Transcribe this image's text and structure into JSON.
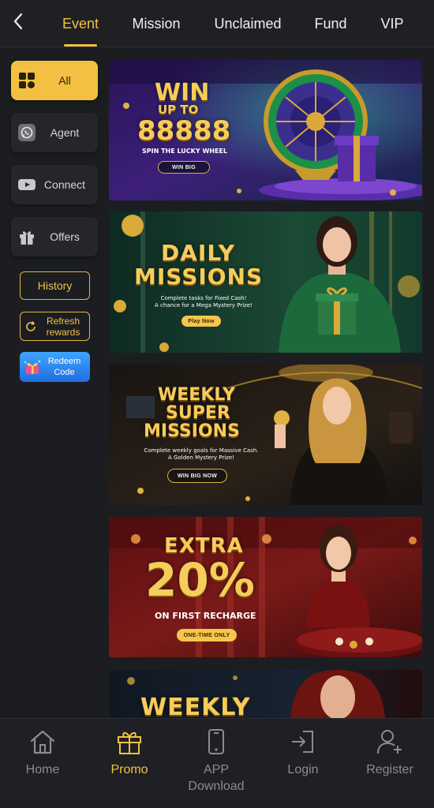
{
  "header": {
    "tabs": [
      {
        "label": "Event",
        "active": true
      },
      {
        "label": "Mission"
      },
      {
        "label": "Unclaimed"
      },
      {
        "label": "Fund"
      },
      {
        "label": "VIP"
      }
    ]
  },
  "sidebar": {
    "categories": [
      {
        "label": "All",
        "icon": "grid-icon",
        "active": true
      },
      {
        "label": "Agent",
        "icon": "whatsapp-icon"
      },
      {
        "label": "Connect",
        "icon": "youtube-icon"
      },
      {
        "label": "Offers",
        "icon": "gift-icon"
      }
    ],
    "history_label": "History",
    "refresh_label_1": "Refresh",
    "refresh_label_2": "rewards",
    "redeem_label_1": "Redeem",
    "redeem_label_2": "Code"
  },
  "banners": {
    "b1": {
      "line1": "WIN",
      "line2": "UP TO",
      "line3": "88888",
      "subtitle": "SPIN THE LUCKY WHEEL",
      "button": "WIN BIG"
    },
    "b2": {
      "line1": "DAILY",
      "line2": "MISSIONS",
      "desc1": "Complete tasks for Fixed Cash!",
      "desc2": "A chance for a Mega Mystery Prize!",
      "button": "Play Now"
    },
    "b3": {
      "line1": "WEEKLY",
      "line2": "SUPER",
      "line3": "MISSIONS",
      "desc1": "Complete weekly goals for Massive Cash.",
      "desc2": "A Golden Mystery Prize!",
      "button": "WIN BIG NOW"
    },
    "b4": {
      "line1": "EXTRA",
      "line2": "20%",
      "subtitle": "ON FIRST RECHARGE",
      "button": "ONE-TIME ONLY"
    },
    "b5": {
      "line1": "WEEKLY"
    }
  },
  "bottom_nav": [
    {
      "label": "Home",
      "icon": "home-icon"
    },
    {
      "label": "Promo",
      "icon": "gift-box-icon",
      "active": true
    },
    {
      "label": "APP Download",
      "icon": "phone-icon"
    },
    {
      "label": "Login",
      "icon": "login-icon"
    },
    {
      "label": "Register",
      "icon": "add-user-icon"
    }
  ],
  "colors": {
    "accent": "#f3c042",
    "background": "#1c1d21",
    "redeem": "#2f8cf5"
  }
}
